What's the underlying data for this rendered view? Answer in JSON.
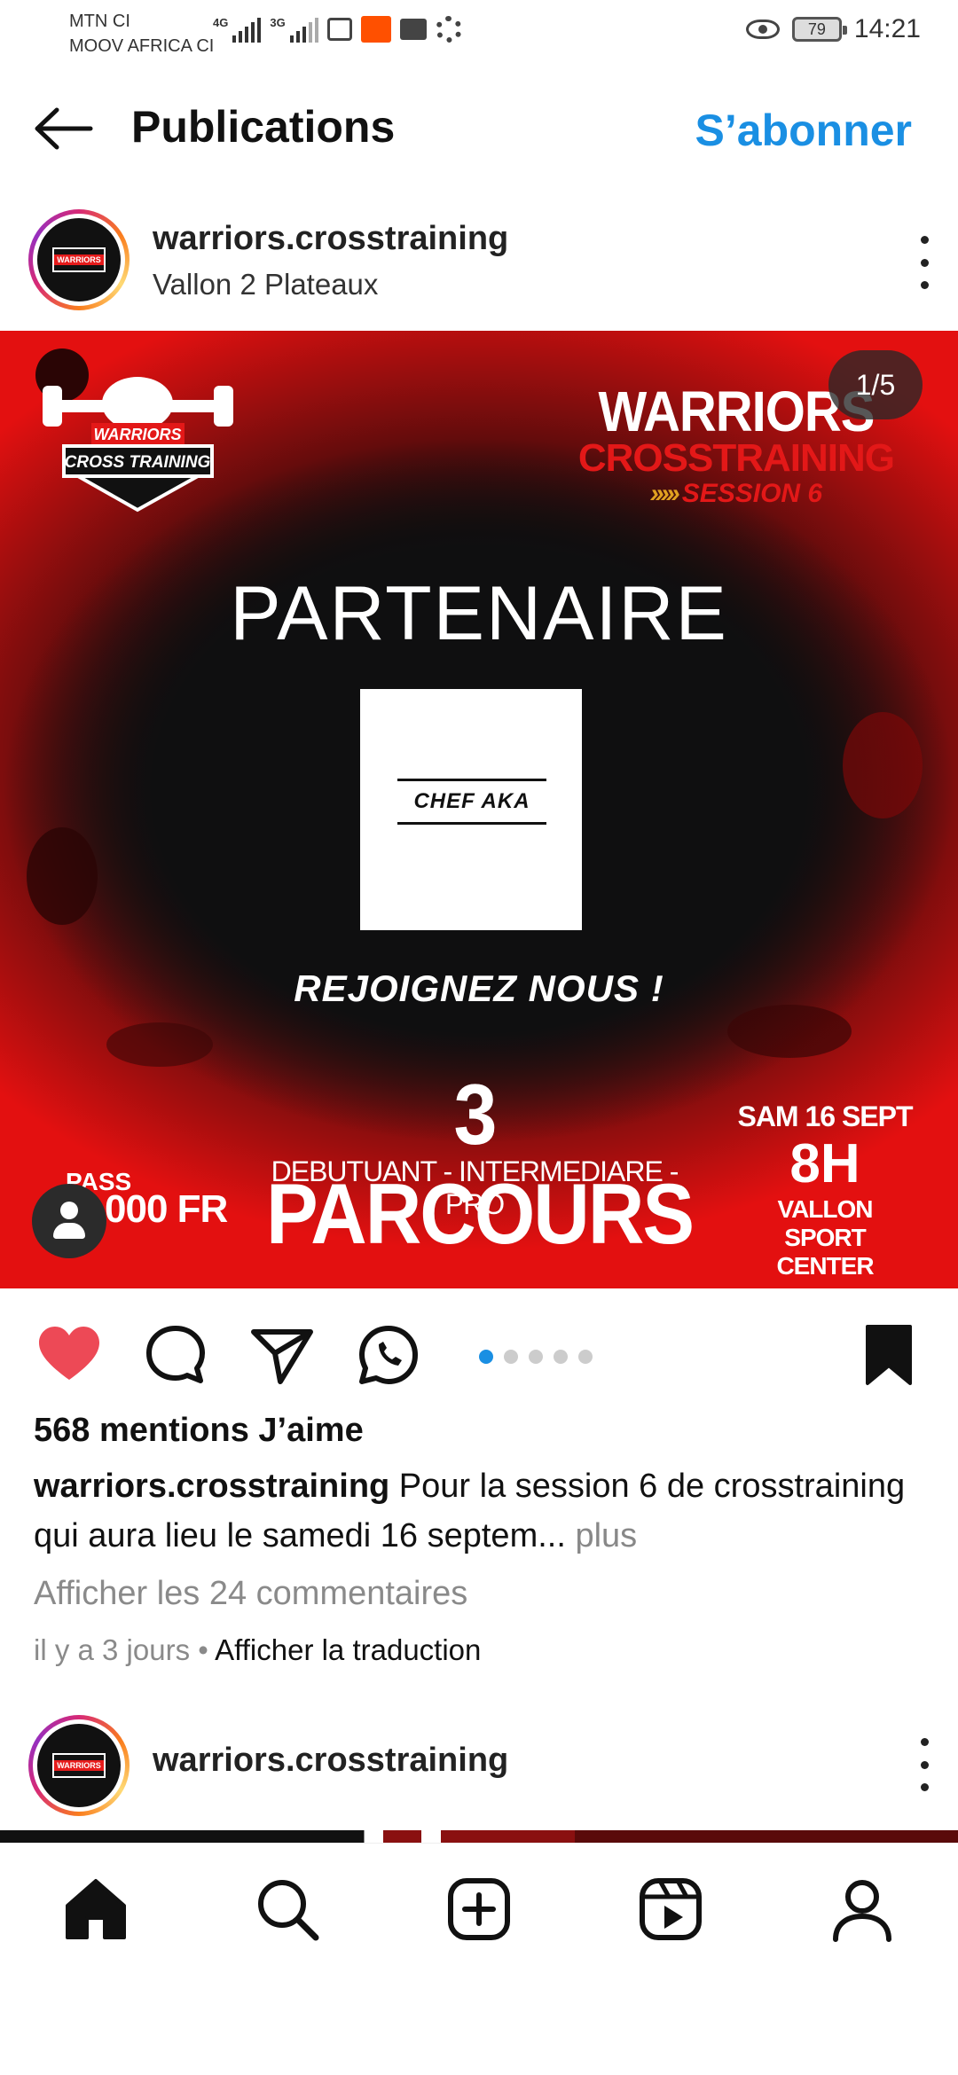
{
  "status_bar": {
    "carrier_1": "MTN CI",
    "carrier_2": "MOOV AFRICA CI",
    "signal_1_tag": "4G",
    "signal_2_tag": "3G",
    "battery": "79",
    "time": "14:21"
  },
  "header": {
    "title": "Publications",
    "subscribe_label": "S’abonner",
    "back_icon": "arrow-left-icon"
  },
  "post": {
    "username": "warriors.crosstraining",
    "location": "Vallon 2 Plateaux",
    "image": {
      "counter": "1/5",
      "logo_text_top": "WARRIORS",
      "logo_text_bottom": "CROSS TRAINING",
      "title_line1": "WARRIORS",
      "title_line2": "CROSSTRAINING",
      "title_line3": "SESSION 6",
      "heading": "PARTENAIRE",
      "partner_name": "CHEF AKA",
      "cta": "REJOIGNEZ NOUS !",
      "parcours": "3 PARCOURS",
      "levels": "DEBUTUANT - INTERMEDIARE - PRO",
      "pass_label": "PASS",
      "pass_price": "000 FR",
      "date": "SAM 16 SEPT",
      "hour": "8H",
      "venue_line1": "VALLON SPORT",
      "venue_line2": "CENTER"
    },
    "carousel": {
      "total": 5,
      "active": 0
    },
    "likes": "568 mentions J’aime",
    "caption_user": "warriors.crosstraining",
    "caption_text": " Pour la session 6 de crosstraining qui aura lieu le samedi 16 septem...",
    "caption_more": " plus",
    "comments_link": "Afficher les 24 commentaires",
    "time_ago": "il y a 3 jours",
    "separator": " • ",
    "translate_link": "Afficher la traduction"
  },
  "next_post": {
    "username": "warriors.crosstraining"
  },
  "colors": {
    "accent": "#1a8fe3",
    "like": "#ed4956",
    "poster_red": "#e31010",
    "poster_dark": "#0f0f10"
  },
  "bottom_nav": [
    {
      "icon": "home-icon"
    },
    {
      "icon": "search-icon"
    },
    {
      "icon": "create-post-icon"
    },
    {
      "icon": "reels-icon"
    },
    {
      "icon": "profile-icon"
    }
  ]
}
